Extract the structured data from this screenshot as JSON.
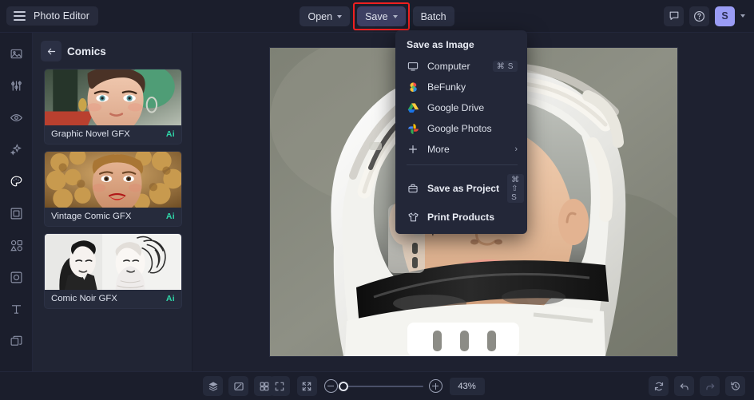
{
  "app": {
    "title": "Photo Editor"
  },
  "topbar": {
    "menu_icon": "hamburger-icon",
    "buttons": [
      {
        "label": "Open",
        "has_caret": true
      },
      {
        "label": "Save",
        "has_caret": true,
        "active": true,
        "highlighted": true
      },
      {
        "label": "Batch",
        "has_caret": false
      }
    ],
    "right": {
      "feedback_icon": "chat-icon",
      "help_icon": "question-circle-icon",
      "avatar_initial": "S",
      "avatar_color": "#9a9cf5",
      "account_caret": "chevron-down-icon"
    }
  },
  "save_menu": {
    "header": "Save as Image",
    "items": [
      {
        "label": "Computer",
        "icon": "monitor-icon",
        "shortcut": "⌘ S"
      },
      {
        "label": "BeFunky",
        "icon": "befunky-logo-icon",
        "shortcut": ""
      },
      {
        "label": "Google Drive",
        "icon": "google-drive-icon",
        "shortcut": ""
      },
      {
        "label": "Google Photos",
        "icon": "google-photos-icon",
        "shortcut": ""
      },
      {
        "label": "More",
        "icon": "plus-icon",
        "shortcut": "",
        "submenu_arrow": "›"
      }
    ],
    "footer_items": [
      {
        "label": "Save as Project",
        "icon": "project-icon",
        "shortcut": "⌘ ⇧ S",
        "bold": true
      },
      {
        "label": "Print Products",
        "icon": "tshirt-icon",
        "shortcut": "",
        "bold": true
      }
    ]
  },
  "rail": {
    "items": [
      {
        "name": "image-icon",
        "selected": false
      },
      {
        "name": "adjust-sliders-icon",
        "selected": false
      },
      {
        "name": "eye-retouch-icon",
        "selected": false
      },
      {
        "name": "effects-sparkle-icon",
        "selected": false
      },
      {
        "name": "artsy-palette-icon",
        "selected": true
      },
      {
        "name": "frames-icon",
        "selected": false
      },
      {
        "name": "graphics-shapes-icon",
        "selected": false
      },
      {
        "name": "overlays-icon",
        "selected": false
      },
      {
        "name": "text-icon",
        "selected": false
      },
      {
        "name": "layers-manager-icon",
        "selected": false
      }
    ]
  },
  "panel": {
    "back_icon": "arrow-left-icon",
    "title": "Comics",
    "cards": [
      {
        "label": "Graphic Novel GFX",
        "badge": "Ai"
      },
      {
        "label": "Vintage Comic GFX",
        "badge": "Ai"
      },
      {
        "label": "Comic Noir GFX",
        "badge": "Ai"
      }
    ]
  },
  "canvas": {
    "image_description": "Illustrated portrait of a child wearing a white space helmet with dark visor"
  },
  "bottombar": {
    "left_tools": [
      {
        "name": "layers-icon"
      },
      {
        "name": "compare-icon"
      },
      {
        "name": "grid-view-icon"
      }
    ],
    "center_tools": [
      {
        "name": "fit-to-screen-icon"
      },
      {
        "name": "actual-size-icon"
      }
    ],
    "zoom": {
      "minus_icon": "zoom-out-icon",
      "plus_icon": "zoom-in-icon",
      "value": "43%",
      "slider_percent": 0
    },
    "right_tools": [
      {
        "name": "reset-icon",
        "disabled": false
      },
      {
        "name": "undo-icon",
        "disabled": false
      },
      {
        "name": "redo-icon",
        "disabled": true
      },
      {
        "name": "history-icon",
        "disabled": false
      }
    ]
  },
  "colors": {
    "accent": "#9a9cf5",
    "highlight": "#ef2020",
    "ai_badge": "#2fd6a8",
    "panel_bg": "#212534",
    "bar_bg": "#1b1e2c",
    "canvas_bg": "#1e2130"
  }
}
